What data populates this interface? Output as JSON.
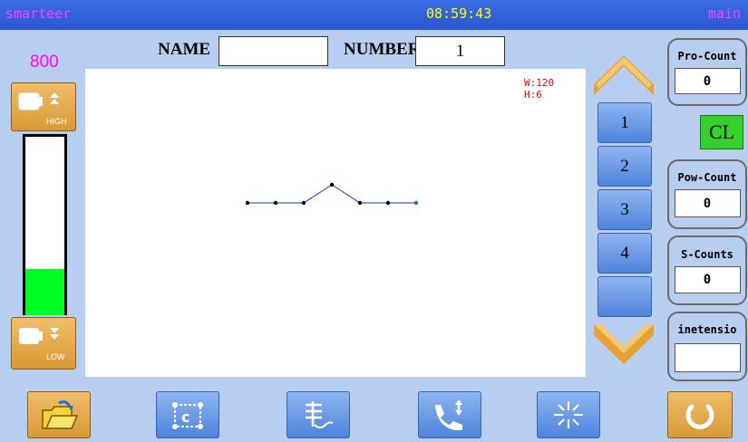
{
  "header": {
    "app": "smarteer",
    "time": "08:59:43",
    "screen": "main"
  },
  "form": {
    "name_label": "NAME",
    "name_value": "",
    "number_label": "NUMBER",
    "number_value": "1"
  },
  "speed": {
    "value": "800",
    "level": 0.26,
    "high_label": "HIGH",
    "low_label": "LOW"
  },
  "pattern": {
    "w": "W:120",
    "h": "H:6",
    "points": [
      [
        0,
        0
      ],
      [
        1,
        0
      ],
      [
        2,
        0
      ],
      [
        3,
        1
      ],
      [
        4,
        0
      ],
      [
        5,
        0
      ],
      [
        6,
        0
      ]
    ]
  },
  "numbers": [
    "1",
    "2",
    "3",
    "4",
    ""
  ],
  "counters": {
    "pro": {
      "title": "Pro-Count",
      "value": "0"
    },
    "clear": "CL",
    "pow": {
      "title": "Pow-Count",
      "value": "0"
    },
    "s": {
      "title": "S-Counts",
      "value": "0"
    },
    "tension": {
      "title": "inetensio",
      "value": ""
    }
  },
  "toolbar": [
    "open-folder-icon",
    "pattern-edit-icon",
    "thread-icon",
    "sewing-icon",
    "settings-icon",
    "power-icon"
  ],
  "colors": {
    "title_text": "#ff44ff",
    "time_text": "#ffff00",
    "speed_text": "#ff00ff",
    "level_fill": "#00ff22",
    "dim_text": "#ee0000",
    "stitch_line": "#1a2ed0"
  }
}
